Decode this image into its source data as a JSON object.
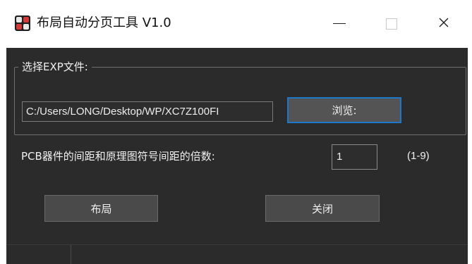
{
  "window": {
    "title": "布局自动分页工具 V1.0",
    "app_icon": "app-logo-icon",
    "controls": [
      "minimize-icon",
      "maximize-icon",
      "close-icon"
    ]
  },
  "file_group": {
    "legend": "选择EXP文件:",
    "path_value": "C:/Users/LONG/Desktop/WP/XC7Z100FI",
    "browse_label": "浏览:"
  },
  "multiplier": {
    "label": "PCB器件的间距和原理图符号间距的倍数:",
    "value": "1",
    "range": "(1-9)"
  },
  "actions": {
    "layout_label": "布局",
    "close_label": "关闭"
  },
  "colors": {
    "background": "#2b2b2b",
    "focus_border": "#1e78c8",
    "button": "#4a4a4a"
  }
}
